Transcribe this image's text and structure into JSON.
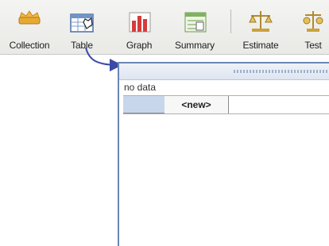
{
  "toolbar": {
    "items": [
      {
        "label": "Collection",
        "icon": "collection-icon"
      },
      {
        "label": "Table",
        "icon": "table-icon"
      },
      {
        "label": "Graph",
        "icon": "graph-icon"
      },
      {
        "label": "Summary",
        "icon": "summary-icon"
      },
      {
        "label": "Estimate",
        "icon": "estimate-icon"
      },
      {
        "label": "Test",
        "icon": "test-icon"
      }
    ]
  },
  "table_window": {
    "status": "no data",
    "new_column": "<new>"
  },
  "colors": {
    "window_border": "#6b86b6",
    "selected_cell": "#c7d6ea",
    "arrow": "#3a4aa5"
  }
}
